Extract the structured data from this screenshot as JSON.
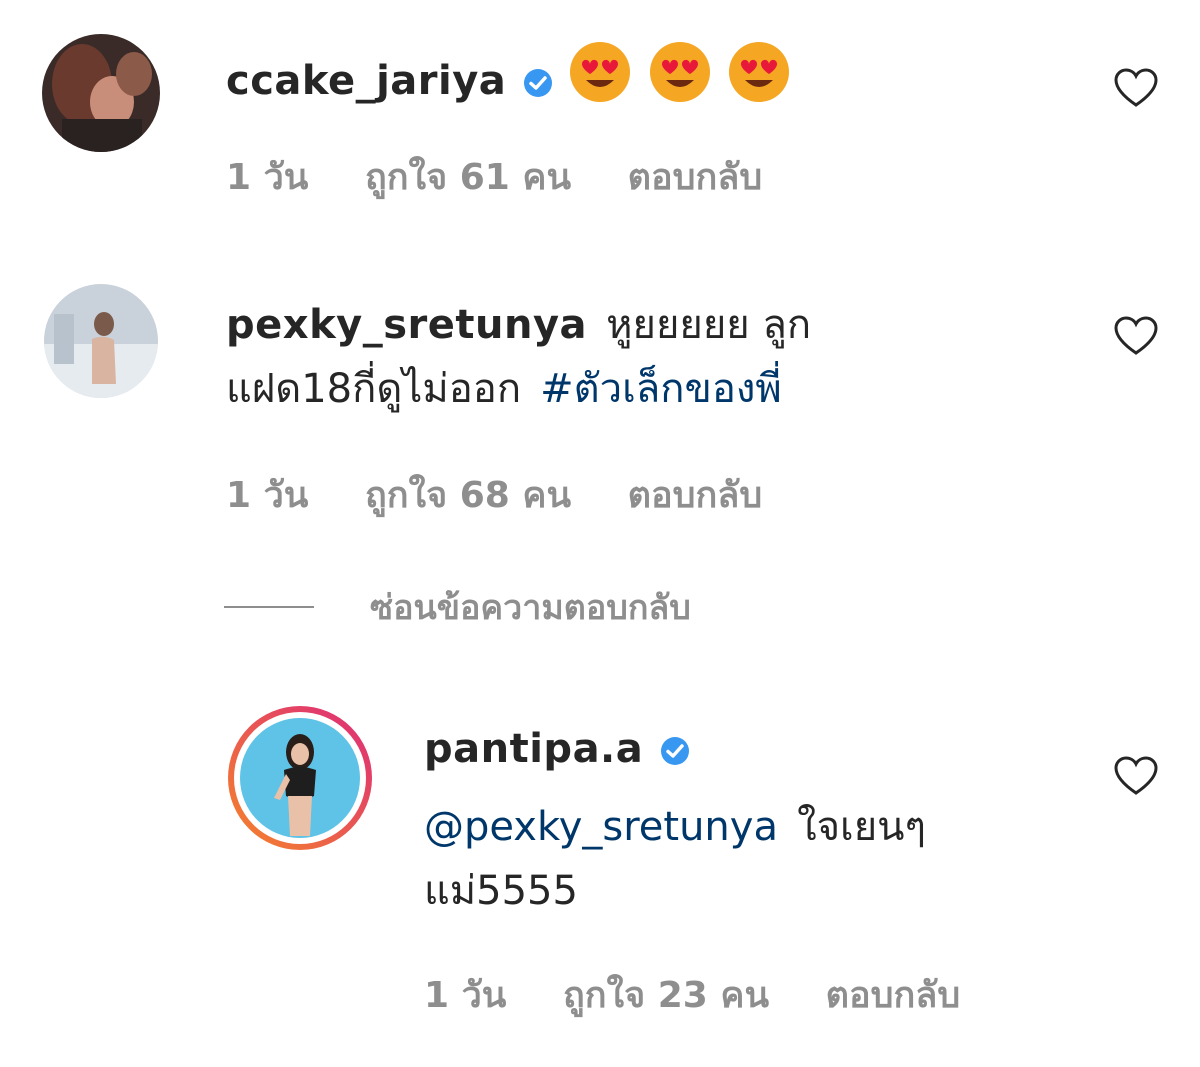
{
  "comments": [
    {
      "username": "ccake_jariya",
      "text": "😍😍😍",
      "verified": true,
      "time": "1 วัน",
      "likes": "ถูกใจ 61 คน",
      "reply": "ตอบกลับ"
    },
    {
      "username": "pexky_sretunya",
      "text_line1": "หูยยยยย ลูก",
      "text_line2": "แฝด18กี่ดูไม่ออก",
      "hashtag": "#ตัวเล็กของพี่",
      "time": "1 วัน",
      "likes": "ถูกใจ 68 คน",
      "reply": "ตอบกลับ"
    }
  ],
  "hide_replies": "ซ่อนข้อความตอบกลับ",
  "reply_comment": {
    "username": "pantipa.a",
    "verified": true,
    "mention": "@pexky_sretunya",
    "text_line1": "ใจเยนๆ",
    "text_line2": "แม่5555",
    "time": "1 วัน",
    "likes": "ถูกใจ 23 คน",
    "reply": "ตอบกลับ"
  },
  "icons": {
    "verified": "verified-badge-icon",
    "heart": "heart-outline-icon",
    "emoji": "heart-eyes-emoji"
  },
  "colors": {
    "verified": "#3897f0",
    "link": "#00376b",
    "meta": "#8e8e8e",
    "story_ring_start": "#f58529",
    "story_ring_end": "#dd2a7b"
  }
}
